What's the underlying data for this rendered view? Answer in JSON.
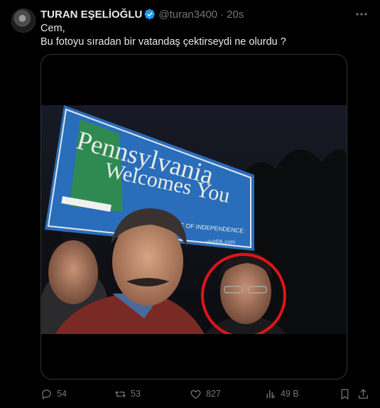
{
  "tweet": {
    "display_name": "TURAN EŞELİOĞLU",
    "handle": "@turan3400",
    "separator": "·",
    "time": "20s",
    "text_line1": "Cem,",
    "text_line2": "Bu fotoyu sıradan bir vatandaş çektirseydi ne olurdu ?",
    "verified_color": "#1d9bf0"
  },
  "photo": {
    "sign_line1": "Pennsylvania",
    "sign_line2": "Welcomes You",
    "sign_line3": "STATE OF INDEPENDENCE",
    "sign_line4": "visitPA.com"
  },
  "actions": {
    "replies": "54",
    "retweets": "53",
    "likes": "827",
    "views": "49 B"
  },
  "icons": [
    "avatar",
    "verified-badge-icon",
    "more-icon",
    "reply-icon",
    "retweet-icon",
    "like-icon",
    "views-icon",
    "bookmark-icon",
    "share-icon"
  ]
}
